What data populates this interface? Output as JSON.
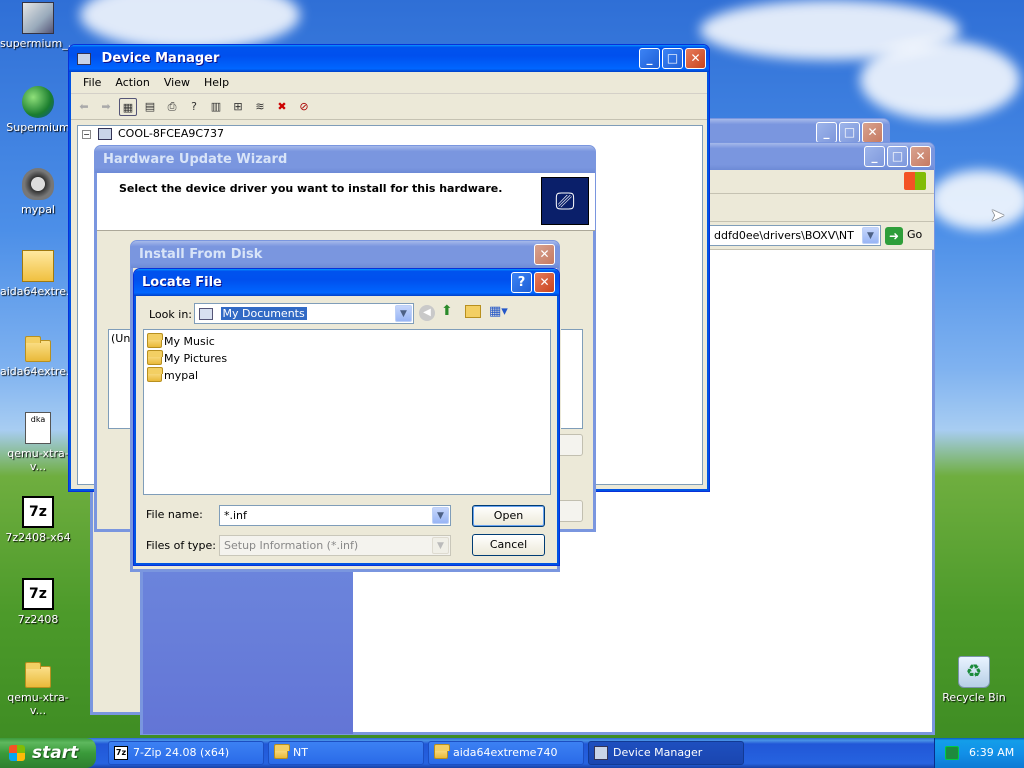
{
  "desktop": {
    "icons": [
      {
        "label": "supermium_..."
      },
      {
        "label": "Supermium"
      },
      {
        "label": "mypal"
      },
      {
        "label": "aida64extre..."
      },
      {
        "label": "aida64extre..."
      },
      {
        "label": "qemu-xtra-v..."
      },
      {
        "label": "7z2408-x64"
      },
      {
        "label": "7z2408"
      },
      {
        "label": "qemu-xtra-v..."
      },
      {
        "label": "Recycle Bin"
      }
    ]
  },
  "device_manager": {
    "title": "Device Manager",
    "menu": [
      "File",
      "Action",
      "View",
      "Help"
    ],
    "tree_root": "COOL-8FCEA9C737"
  },
  "explorer": {
    "address": "ddfd0ee\\drivers\\BOXV\\NT",
    "go_label": "Go"
  },
  "hw_wizard": {
    "title": "Hardware Update Wizard",
    "heading": "Select the device driver you want to install for this hardware.",
    "list_fragment": "(Una"
  },
  "install_disk": {
    "title": "Install From Disk"
  },
  "locate_file": {
    "title": "Locate File",
    "look_in_label": "Look in:",
    "look_in_value": "My Documents",
    "items": [
      {
        "name": "My Music"
      },
      {
        "name": "My Pictures"
      },
      {
        "name": "mypal"
      }
    ],
    "file_name_label": "File name:",
    "file_name_value": "*.inf",
    "file_type_label": "Files of type:",
    "file_type_value": "Setup Information (*.inf)",
    "open_label": "Open",
    "cancel_label": "Cancel"
  },
  "taskbar": {
    "start_label": "start",
    "tasks": [
      {
        "label": "7-Zip 24.08 (x64)"
      },
      {
        "label": "NT"
      },
      {
        "label": "aida64extreme740"
      },
      {
        "label": "Device Manager"
      }
    ],
    "clock": "6:39 AM"
  },
  "colors": {
    "xp_blue": "#0054e3",
    "window_bg": "#ece9d8",
    "selection": "#316ac5"
  }
}
